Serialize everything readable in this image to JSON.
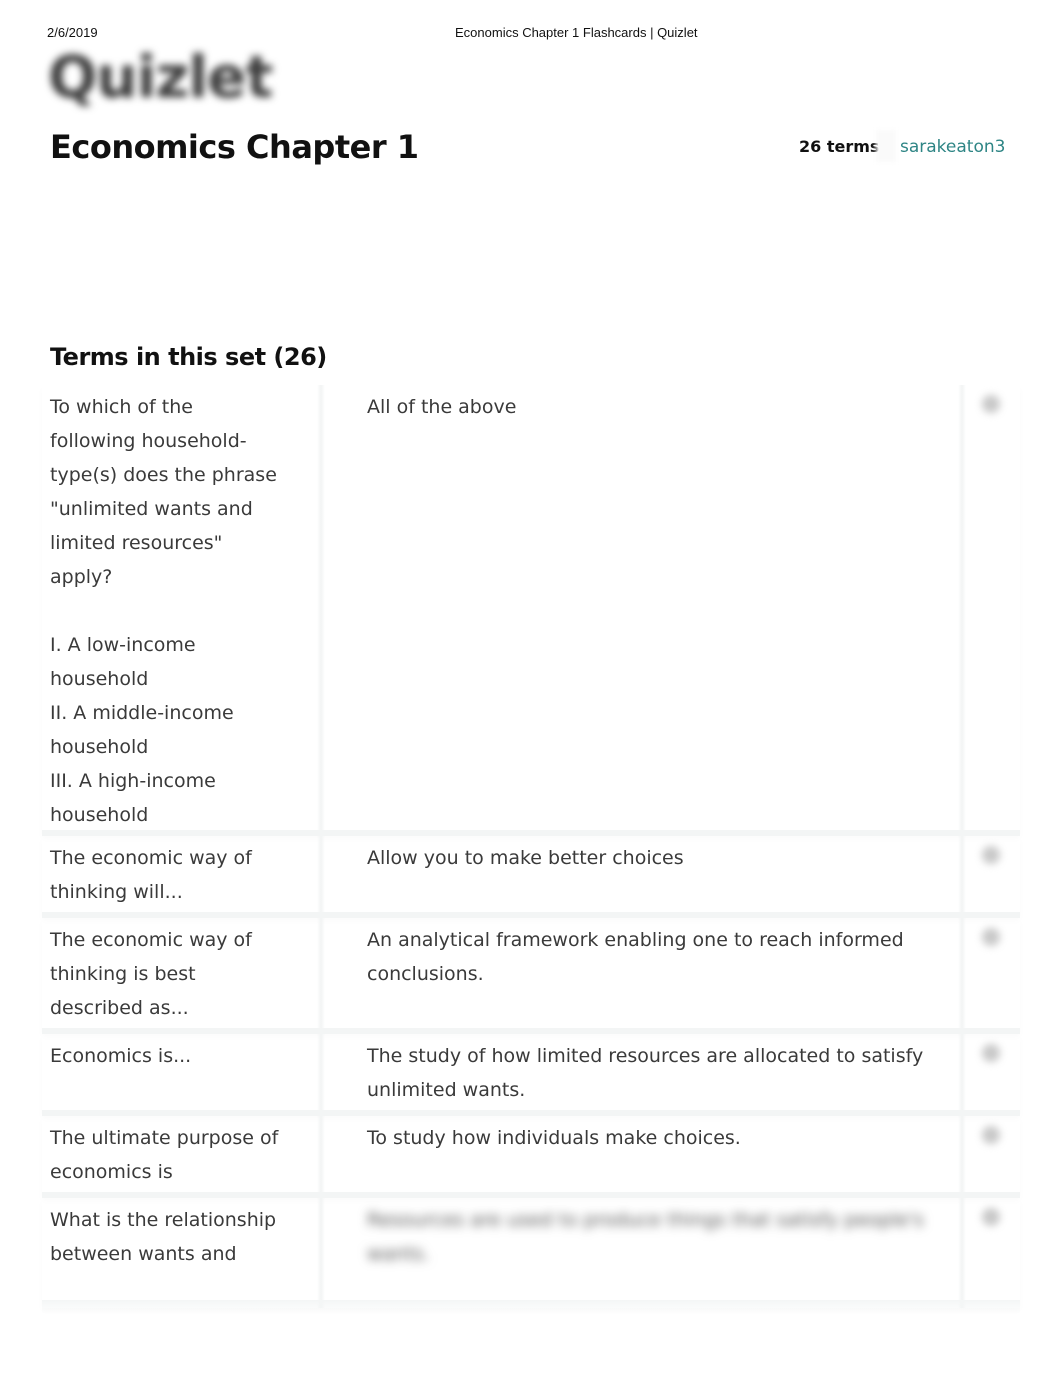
{
  "print_header": {
    "date": "2/6/2019",
    "page_title": "Economics Chapter 1 Flashcards | Quizlet"
  },
  "brand": {
    "logo_text": "Quizlet"
  },
  "set": {
    "title": "Economics Chapter 1",
    "term_count_label": "26 terms",
    "author": "sarakeaton3",
    "author_color": "#2e8585"
  },
  "terms_section": {
    "heading": "Terms in this set (26)",
    "terms": [
      {
        "term": "To which of the\nfollowing household-\ntype(s) does the phrase\n\"unlimited wants and\nlimited resources\"\napply?\n\nI. A low-income\nhousehold\nII. A middle-income\nhousehold\nIII. A high-income\nhousehold",
        "definition": "All of the above",
        "icon": "audio-icon"
      },
      {
        "term": "The economic way of\nthinking will...",
        "definition": "Allow you to make better choices",
        "icon": "audio-icon"
      },
      {
        "term": "The economic way of\nthinking is best\ndescribed as...",
        "definition": "An analytical framework enabling one to reach informed\nconclusions.",
        "icon": "audio-icon"
      },
      {
        "term": "Economics is...",
        "definition": "The study of how limited resources are allocated to satisfy\nunlimited wants.",
        "icon": "audio-icon"
      },
      {
        "term": "The ultimate purpose of\neconomics is",
        "definition": "To study how individuals make choices.",
        "icon": "audio-icon"
      },
      {
        "term": "What is the relationship\nbetween wants and",
        "definition": "Resources are used to produce things that satisfy people's\nwants.",
        "definition_blurred": true,
        "icon": "audio-icon"
      }
    ]
  }
}
